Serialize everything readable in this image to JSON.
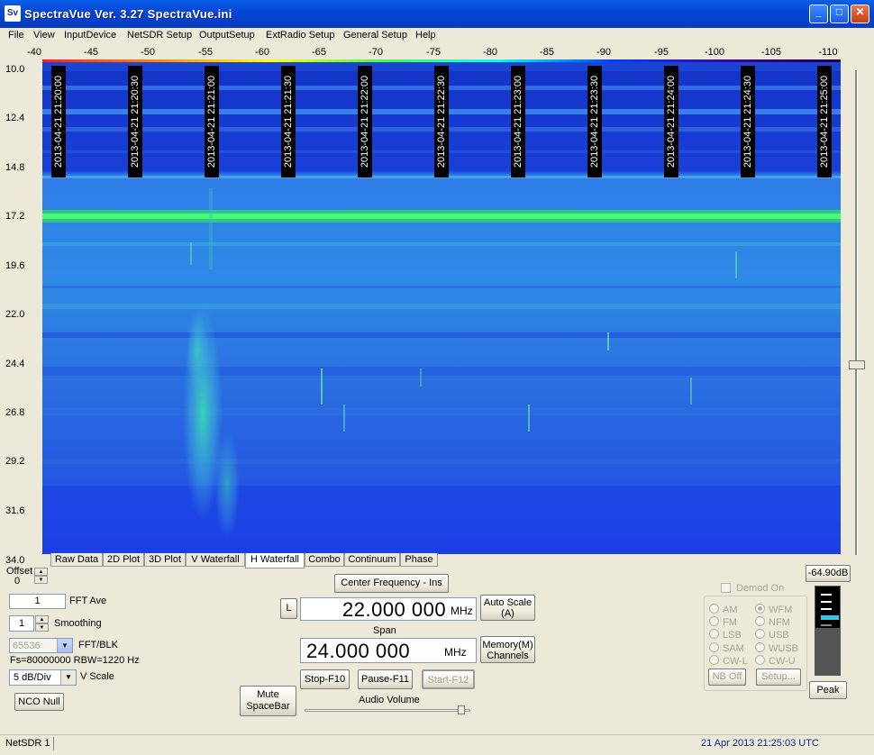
{
  "window": {
    "title": "SpectraVue Ver. 3.27  SpectraVue.ini",
    "logo": "Sv",
    "minimize": "_",
    "maximize": "□",
    "close": "✕"
  },
  "menu": [
    "File",
    "View",
    "InputDevice",
    "NetSDR Setup",
    "OutputSetup",
    "ExtRadio Setup",
    "General Setup",
    "Help"
  ],
  "freq_axis": [
    "-40",
    "-45",
    "-50",
    "-55",
    "-60",
    "-65",
    "-70",
    "-75",
    "-80",
    "-85",
    "-90",
    "-95",
    "-100",
    "-105",
    "-110"
  ],
  "time_axis": [
    "10.0",
    "12.4",
    "14.8",
    "17.2",
    "19.6",
    "22.0",
    "24.4",
    "26.8",
    "29.2",
    "31.6",
    "34.0"
  ],
  "timestamps": [
    "2013-04-21 21:20:00",
    "2013-04-21 21:20:30",
    "2013-04-21 21:21:00",
    "2013-04-21 21:21:30",
    "2013-04-21 21:22:00",
    "2013-04-21 21:22:30",
    "2013-04-21 21:23:00",
    "2013-04-21 21:23:30",
    "2013-04-21 21:24:00",
    "2013-04-21 21:24:30",
    "2013-04-21 21:25:00"
  ],
  "tabs": [
    "Raw Data",
    "2D Plot",
    "3D Plot",
    "V Waterfall",
    "H Waterfall",
    "Combo",
    "Continuum",
    "Phase"
  ],
  "active_tab": "H Waterfall",
  "controls": {
    "offset_label": "Offset",
    "offset_value": "0",
    "fft_ave_value": "1",
    "fft_ave_label": "FFT Ave",
    "smoothing_value": "1",
    "smoothing_label": "Smoothing",
    "fft_blk_value": "65536",
    "fft_blk_label": "FFT/BLK",
    "fs_info": "Fs=80000000 RBW=1220 Hz",
    "vscale_value": "5 dB/Div",
    "vscale_label": "V Scale",
    "nco_null": "NCO Null",
    "mute": "Mute\nSpaceBar",
    "center_freq_button": "Center Frequency - Ins",
    "l_button": "L",
    "center_freq_value": "22.000 000",
    "mhz": "MHz",
    "auto_scale": "Auto Scale\n(A)",
    "span_label": "Span",
    "span_value": "24.000 000",
    "memory": "Memory(M)\nChannels",
    "stop": "Stop-F10",
    "pause": "Pause-F11",
    "start": "Start-F12",
    "audio_volume": "Audio Volume",
    "demod_on": "Demod On",
    "modes_left": [
      "AM",
      "FM",
      "LSB",
      "SAM",
      "CW-L"
    ],
    "modes_right": [
      "WFM",
      "NFM",
      "USB",
      "WUSB",
      "CW-U"
    ],
    "selected_mode": "WFM",
    "nb_off": "NB Off",
    "setup": "Setup...",
    "peak_value": "-64.90dB",
    "peak": "Peak"
  },
  "status": {
    "device": "NetSDR 1",
    "datetime": "21 Apr 2013  21:25:03 UTC"
  },
  "colors": {
    "title_bar": "#0447d6",
    "waterfall_base": "#1d4ee6",
    "highlight": "#40ff80",
    "status_time": "#0a2a8a"
  }
}
